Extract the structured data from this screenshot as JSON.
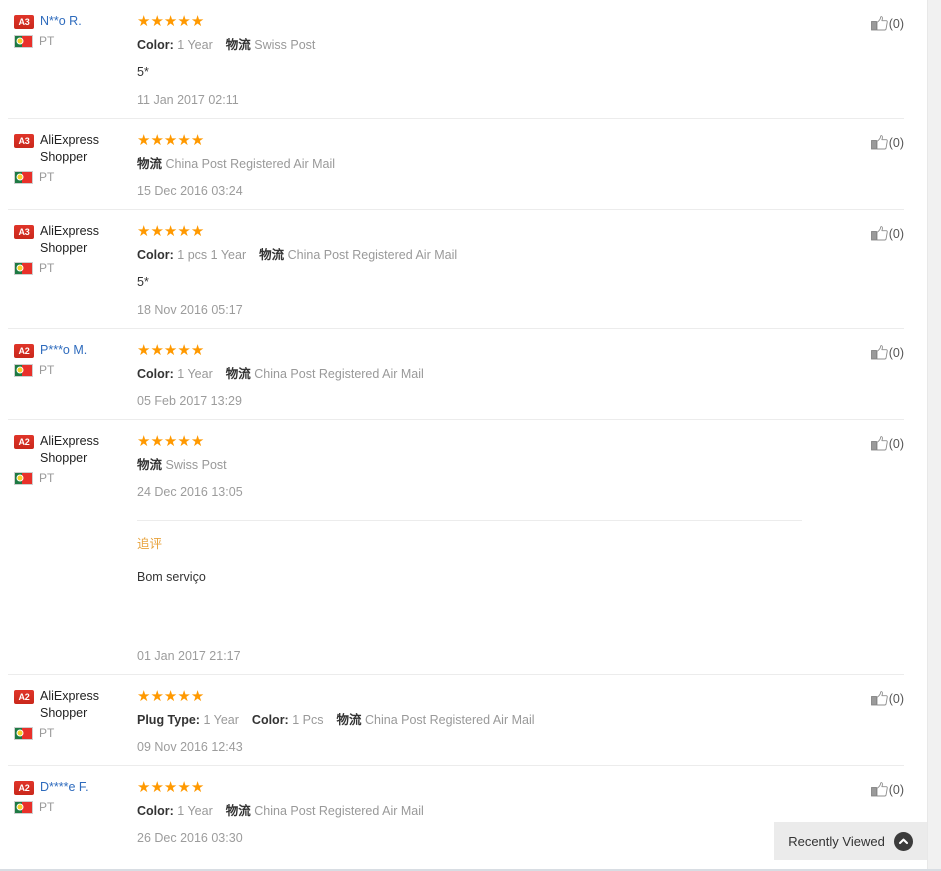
{
  "theme": {
    "star_color": "#ff9900",
    "link_color": "#2e6bbd",
    "badge_color": "#d42f1f",
    "muted_color": "#999999",
    "additional_review_color": "#e8a33d",
    "divider_color": "#ececec"
  },
  "reviews": [
    {
      "rank": "A3",
      "user": "N**o R.",
      "is_link": true,
      "country": "PT",
      "stars": 5,
      "attributes": [
        {
          "label": "Color:",
          "value": "1 Year"
        }
      ],
      "logistics_label": "物流",
      "logistics_value": "Swiss Post",
      "review_text": "5*",
      "date": "11 Jan 2017 02:11",
      "helpful_count": "(0)",
      "additional": null
    },
    {
      "rank": "A3",
      "user": "AliExpress Shopper",
      "is_link": false,
      "country": "PT",
      "stars": 5,
      "attributes": [],
      "logistics_label": "物流",
      "logistics_value": "China Post Registered Air Mail",
      "review_text": null,
      "date": "15 Dec 2016 03:24",
      "helpful_count": "(0)",
      "additional": null
    },
    {
      "rank": "A3",
      "user": "AliExpress Shopper",
      "is_link": false,
      "country": "PT",
      "stars": 5,
      "attributes": [
        {
          "label": "Color:",
          "value": "1 pcs 1 Year"
        }
      ],
      "logistics_label": "物流",
      "logistics_value": "China Post Registered Air Mail",
      "review_text": "5*",
      "date": "18 Nov 2016 05:17",
      "helpful_count": "(0)",
      "additional": null
    },
    {
      "rank": "A2",
      "user": "P***o M.",
      "is_link": true,
      "country": "PT",
      "stars": 5,
      "attributes": [
        {
          "label": "Color:",
          "value": "1 Year"
        }
      ],
      "logistics_label": "物流",
      "logistics_value": "China Post Registered Air Mail",
      "review_text": null,
      "date": "05 Feb 2017 13:29",
      "helpful_count": "(0)",
      "additional": null
    },
    {
      "rank": "A2",
      "user": "AliExpress Shopper",
      "is_link": false,
      "country": "PT",
      "stars": 5,
      "attributes": [],
      "logistics_label": "物流",
      "logistics_value": "Swiss Post",
      "review_text": null,
      "date": "24 Dec 2016 13:05",
      "helpful_count": "(0)",
      "additional": {
        "title": "追评",
        "text": "Bom serviço",
        "date": "01 Jan 2017 21:17"
      }
    },
    {
      "rank": "A2",
      "user": "AliExpress Shopper",
      "is_link": false,
      "country": "PT",
      "stars": 5,
      "attributes": [
        {
          "label": "Plug Type:",
          "value": "1 Year"
        },
        {
          "label": "Color:",
          "value": "1 Pcs"
        }
      ],
      "logistics_label": "物流",
      "logistics_value": "China Post Registered Air Mail",
      "review_text": null,
      "date": "09 Nov 2016 12:43",
      "helpful_count": "(0)",
      "additional": null
    },
    {
      "rank": "A2",
      "user": "D****e F.",
      "is_link": true,
      "country": "PT",
      "stars": 5,
      "attributes": [
        {
          "label": "Color:",
          "value": "1 Year"
        }
      ],
      "logistics_label": "物流",
      "logistics_value": "China Post Registered Air Mail",
      "review_text": null,
      "date": "26 Dec 2016 03:30",
      "helpful_count": "(0)",
      "additional": null
    }
  ],
  "recently_viewed": {
    "label": "Recently Viewed",
    "icon": "chevron-up-icon"
  }
}
